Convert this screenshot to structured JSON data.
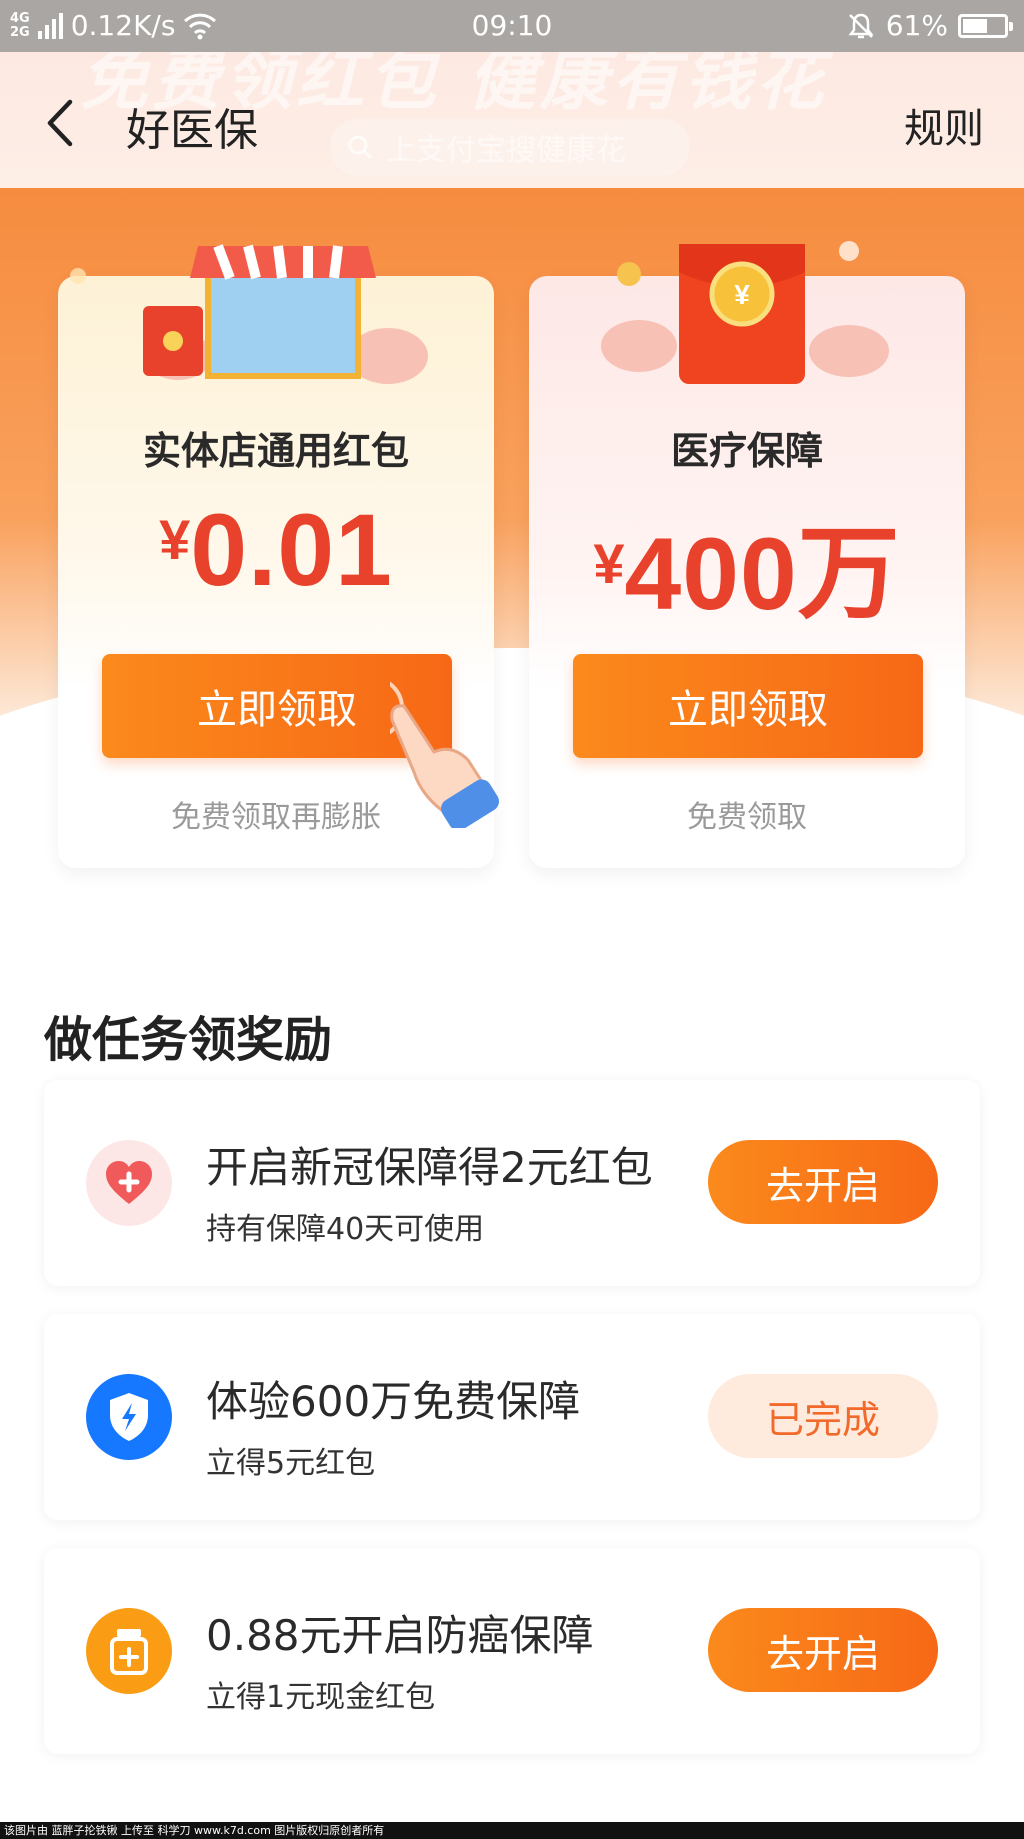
{
  "status_bar": {
    "network_top": "4G",
    "network_bottom": "2G",
    "speed": "0.12K/s",
    "time": "09:10",
    "battery": "61%",
    "battery_level": 0.61
  },
  "header": {
    "title": "好医保",
    "rules_label": "规则",
    "banner_text": "免费领红包 健康有钱花",
    "search_placeholder": "上支付宝搜健康花"
  },
  "cards": [
    {
      "title": "实体店通用红包",
      "currency": "¥",
      "amount": "0.01",
      "button_label": "立即领取",
      "subtext": "免费领取再膨胀"
    },
    {
      "title": "医疗保障",
      "currency": "¥",
      "amount": "400万",
      "button_label": "立即领取",
      "subtext": "免费领取"
    }
  ],
  "tasks_section": {
    "title": "做任务领奖励",
    "items": [
      {
        "title": "开启新冠保障得2元红包",
        "desc": "持有保障40天可使用",
        "button_label": "去开启",
        "state": "active",
        "icon": "heart-plus-icon",
        "icon_color": "#f05a5a"
      },
      {
        "title": "体验600万免费保障",
        "desc": "立得5元红包",
        "button_label": "已完成",
        "state": "done",
        "icon": "shield-lightning-icon",
        "icon_color": "#1677ff"
      },
      {
        "title": "0.88元开启防癌保障",
        "desc": "立得1元现金红包",
        "button_label": "去开启",
        "state": "active",
        "icon": "medicine-bottle-icon",
        "icon_color": "#fa9d14"
      }
    ]
  },
  "footer": {
    "watermark": "该图片由 蓝胖子抡铁锹 上传至 科学刀 www.k7d.com 图片版权归原创者所有"
  },
  "colors": {
    "accent": "#f76816",
    "price_red": "#e8412c",
    "done_bg": "#feebdd"
  }
}
